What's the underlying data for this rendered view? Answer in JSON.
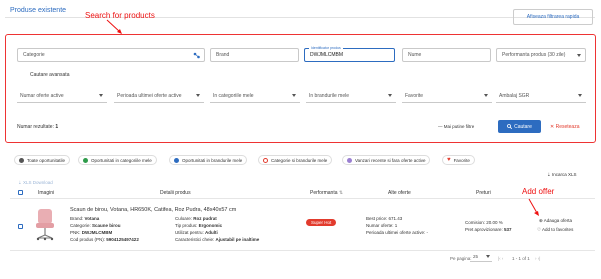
{
  "header": {
    "tab": "Produse existente",
    "annotation_search": "Search for products",
    "quick_filter_button": "Afiseaza filtrarea rapida"
  },
  "filters": {
    "categorie": "Categorie",
    "brand": "Brand",
    "identificator_label": "Identificator produs",
    "identificator_value": "DWJMLCMBM",
    "nume": "Nume",
    "performanta": "Performanta produs (30 zile)",
    "cautare_avansata": "Cautare avansata",
    "numar_oferte": "Numar oferte active",
    "perioada": "Perioada ultimei oferte active",
    "in_categoriile": "In categoriile mele",
    "in_brandurile": "In brandurile mele",
    "favorite": "Favorite",
    "ambalaj": "Ambalaj SGR",
    "results_label": "Numar rezultate:",
    "results_count": "1",
    "less_filters": "Mai putine filtre",
    "search_button": "Cautare",
    "reset_button": "Reseteaza"
  },
  "chips": [
    {
      "label": "Toate oportunitatile",
      "color": "#555555"
    },
    {
      "label": "Oportunitati in categoriile mele",
      "color": "#2e9b4a"
    },
    {
      "label": "Oportunitati in brandurile mele",
      "color": "#2d6cc0"
    },
    {
      "label": "Categorie si brandurile mele",
      "color": "#e23b2d"
    },
    {
      "label": "Vanzari recente si fara oferte active",
      "color": "#9a7fd1"
    },
    {
      "label": "Favorite",
      "color": "#e23b2d"
    }
  ],
  "toolbar": {
    "export": "Incarca XLS",
    "xls_download": "XLS Download"
  },
  "table": {
    "headers": [
      "Imagini",
      "Detalii produs",
      "Performanta",
      "Alte oferte",
      "Preturi"
    ],
    "row": {
      "title": "Scaun de birou, Votana, HR650K, Catifea, Roz Pudra, 48x40x57 cm",
      "brand_label": "Brand:",
      "brand": "Votana",
      "categorie_label": "Categorie:",
      "categorie": "Scaune birou",
      "pnk_label": "PNK:",
      "pnk": "DWJMLCMBM",
      "cod_label": "Cod produs (PN):",
      "cod": "5904125497422",
      "culoare_label": "Culoare:",
      "culoare": "Roz pudrat",
      "tip_label": "Tip produs:",
      "tip": "Ergonomic",
      "utilizat_label": "Utilizat pentru:",
      "utilizat": "Adulti",
      "caract_label": "Caracteristici cheie:",
      "caract": "Ajustabil pe inaltime",
      "performance": "Super Hot",
      "best_price_label": "Best price:",
      "best_price": "671.43",
      "numar_oferte_label": "Numar oferte:",
      "numar_oferte": "1",
      "perioada_label": "Perioada ultimei oferte active:",
      "perioada": "-",
      "comision_label": "Comision:",
      "comision": "20.00 %",
      "pret_label": "Pret aprovizionare:",
      "pret": "537",
      "add_offer": "Adauga oferta",
      "add_favorites": "Add to favorites"
    }
  },
  "annotation_add": "Add offer",
  "pagination": {
    "per_page_label": "Pe pagina:",
    "per_page": "25",
    "range": "1 - 1 of 1"
  }
}
